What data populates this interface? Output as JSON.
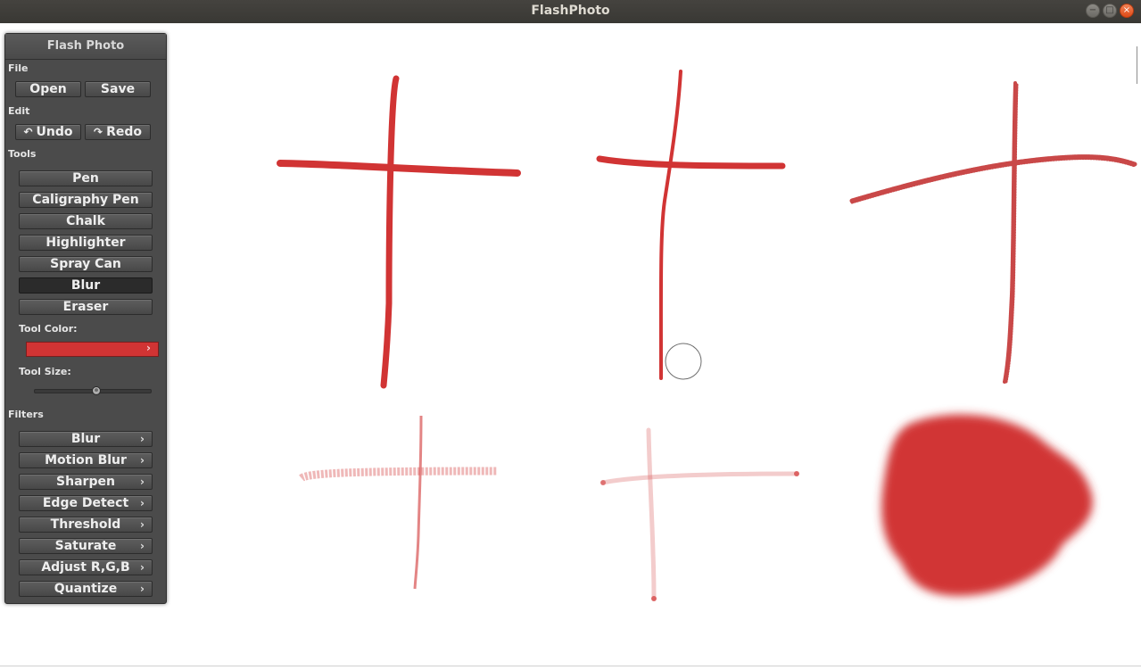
{
  "window": {
    "title": "FlashPhoto",
    "buttons": {
      "minimize_icon": "−",
      "maximize_icon": "□",
      "close_icon": "×"
    }
  },
  "panel": {
    "title": "Flash Photo",
    "file": {
      "label": "File",
      "open": "Open",
      "save": "Save"
    },
    "edit": {
      "label": "Edit",
      "undo": "Undo",
      "redo": "Redo",
      "undo_icon": "↶",
      "redo_icon": "↷"
    },
    "tools": {
      "label": "Tools",
      "items": [
        "Pen",
        "Caligraphy Pen",
        "Chalk",
        "Highlighter",
        "Spray Can",
        "Blur",
        "Eraser"
      ],
      "active": "Blur",
      "color_label": "Tool Color:",
      "color": "#d13434",
      "size_label": "Tool Size:",
      "size_fraction": 0.53
    },
    "filters": {
      "label": "Filters",
      "items": [
        "Blur",
        "Motion Blur",
        "Sharpen",
        "Edge Detect",
        "Threshold",
        "Saturate",
        "Adjust R,G,B",
        "Quantize"
      ]
    },
    "chevron": "›"
  },
  "canvas": {
    "stroke_color": "#d13434",
    "strokes": [
      "pen-cross",
      "caligraphy-cross",
      "chalk-cross",
      "highlighter-cross",
      "spray-can-cross",
      "blur-blob"
    ]
  }
}
